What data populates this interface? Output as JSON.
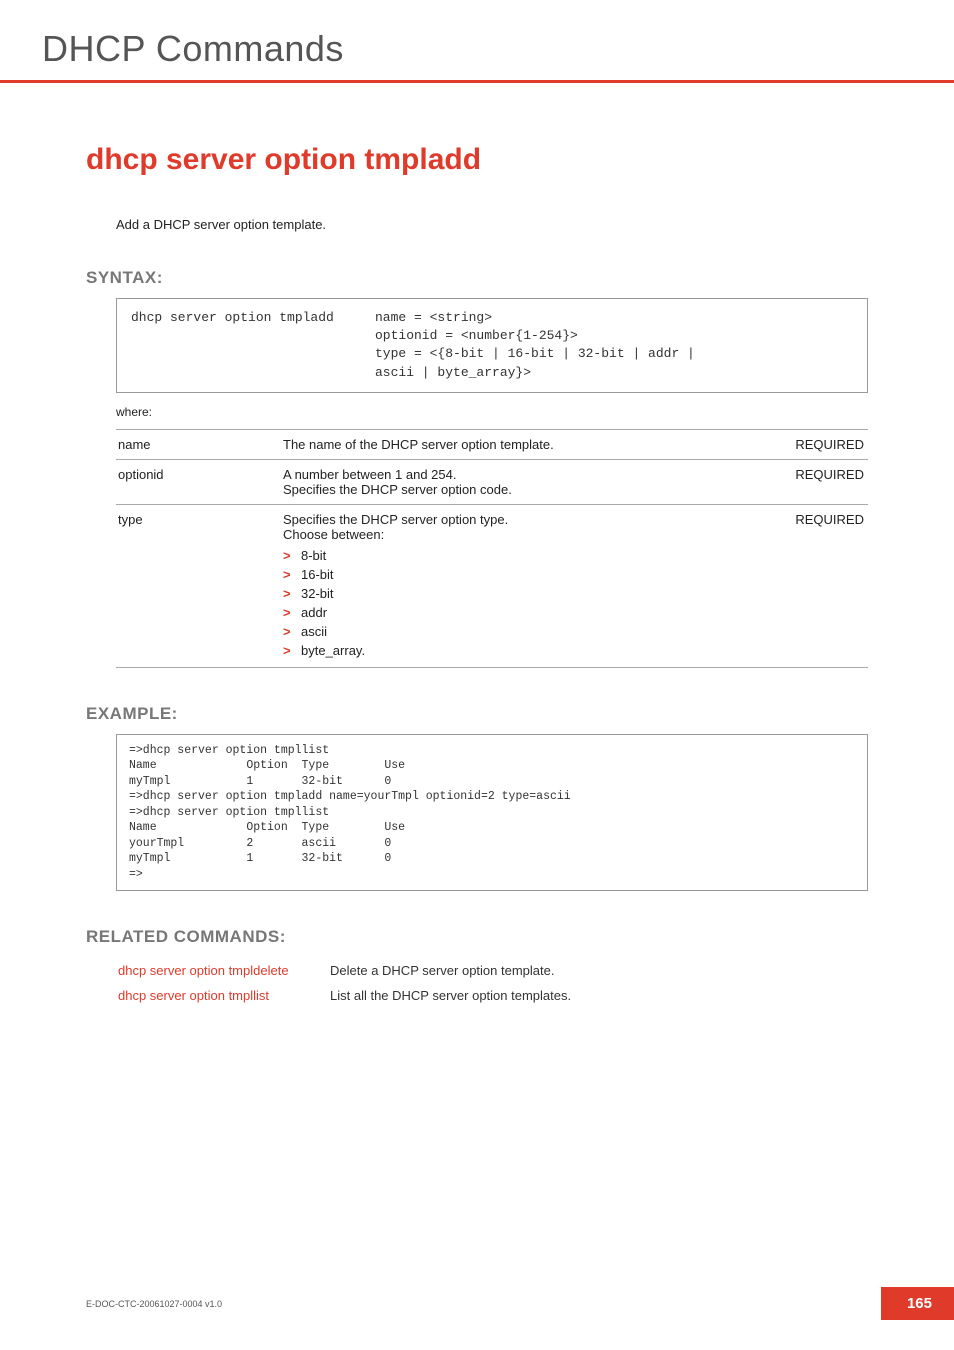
{
  "header": {
    "chapter": "DHCP Commands"
  },
  "command": {
    "title": "dhcp server option tmpladd",
    "intro": "Add a DHCP server option template."
  },
  "syntax": {
    "heading": "SYNTAX:",
    "cmd": "dhcp server option tmpladd",
    "args": "name = <string>\noptionid = <number{1-254}>\ntype = <{8-bit | 16-bit | 32-bit | addr |\nascii | byte_array}>",
    "where": "where:",
    "required_label": "REQUIRED",
    "params": [
      {
        "name": "name",
        "desc": "The name of the DHCP server option template.",
        "required": true
      },
      {
        "name": "optionid",
        "desc": "A number between 1 and 254.\nSpecifies the DHCP server option code.",
        "required": true
      },
      {
        "name": "type",
        "desc": "Specifies the DHCP server option type.\nChoose between:",
        "required": true,
        "options": [
          "8-bit",
          "16-bit",
          "32-bit",
          "addr",
          "ascii",
          "byte_array."
        ]
      }
    ]
  },
  "example": {
    "heading": "EXAMPLE:",
    "text": "=>dhcp server option tmpllist\nName             Option  Type        Use\nmyTmpl           1       32-bit      0\n=>dhcp server option tmpladd name=yourTmpl optionid=2 type=ascii\n=>dhcp server option tmpllist\nName             Option  Type        Use\nyourTmpl         2       ascii       0\nmyTmpl           1       32-bit      0\n=>"
  },
  "related": {
    "heading": "RELATED COMMANDS:",
    "rows": [
      {
        "cmd": "dhcp server option tmpldelete",
        "desc": "Delete a DHCP server option template."
      },
      {
        "cmd": "dhcp server option tmpllist",
        "desc": "List all the DHCP server option templates."
      }
    ]
  },
  "footer": {
    "doc_id": "E-DOC-CTC-20061027-0004 v1.0",
    "page": "165"
  }
}
